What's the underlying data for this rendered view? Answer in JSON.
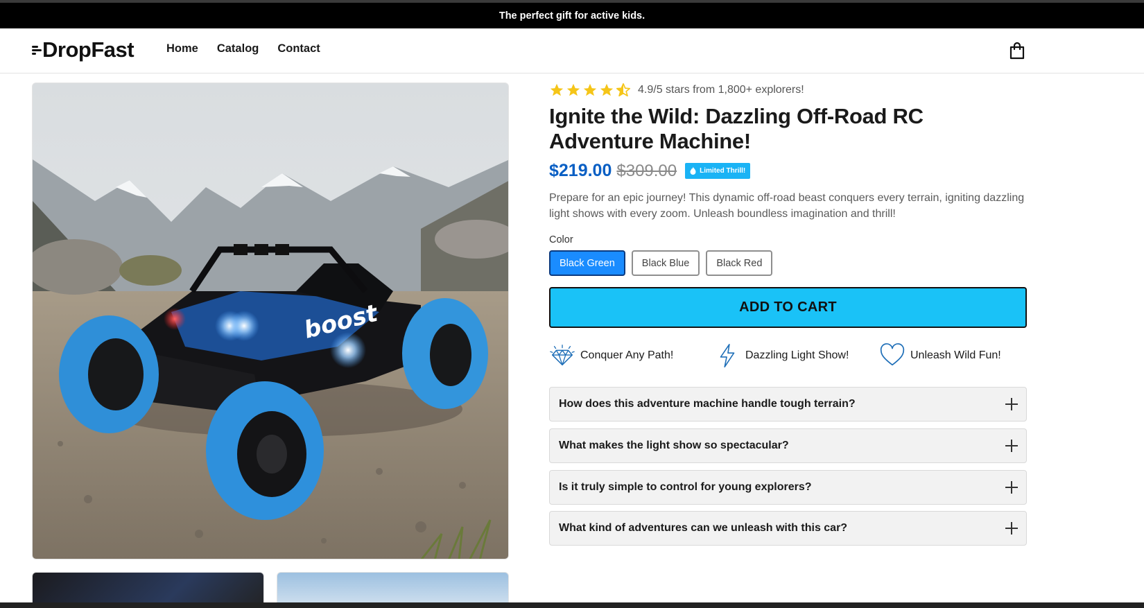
{
  "announcement": "The perfect gift for active kids.",
  "header": {
    "logo": "DropFast",
    "nav": [
      "Home",
      "Catalog",
      "Contact"
    ],
    "cart_icon": "shopping-bag-icon"
  },
  "product": {
    "image_alt": "Blue and black off-road RC car on rocky mountain terrain",
    "rating_stars": 4.5,
    "rating_text": "4.9/5 stars from 1,800+ explorers!",
    "title": "Ignite the Wild: Dazzling Off-Road RC Adventure Machine!",
    "price": "$219.00",
    "compare_price": "$309.00",
    "badge": "Limited Thrill!",
    "description": "Prepare for an epic journey! This dynamic off-road beast conquers every terrain, igniting dazzling light shows with every zoom. Unleash boundless imagination and thrill!",
    "color_label": "Color",
    "colors": [
      "Black Green",
      "Black Blue",
      "Black Red"
    ],
    "selected_color": "Black Green",
    "add_to_cart": "ADD TO CART",
    "features": [
      {
        "icon": "diamond-icon",
        "label": "Conquer Any Path!"
      },
      {
        "icon": "lightning-icon",
        "label": "Dazzling Light Show!"
      },
      {
        "icon": "heart-icon",
        "label": "Unleash Wild Fun!"
      }
    ],
    "faqs": [
      "How does this adventure machine handle tough terrain?",
      "What makes the light show so spectacular?",
      "Is it truly simple to control for young explorers?",
      "What kind of adventures can we unleash with this car?"
    ]
  },
  "colors": {
    "accent_blue": "#1ac2f7",
    "price_blue": "#0a5fc4",
    "swatch_active": "#1a8cff",
    "star_yellow": "#f5c518"
  }
}
